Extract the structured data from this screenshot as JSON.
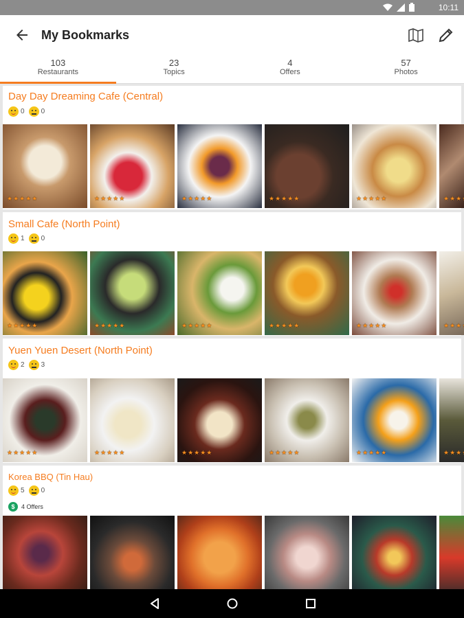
{
  "status": {
    "time": "10:11"
  },
  "header": {
    "title": "My Bookmarks"
  },
  "tabs": [
    {
      "count": "103",
      "label": "Restaurants"
    },
    {
      "count": "23",
      "label": "Topics"
    },
    {
      "count": "4",
      "label": "Offers"
    },
    {
      "count": "57",
      "label": "Photos"
    }
  ],
  "restaurants": [
    {
      "name": "Day Day Dreaming Cafe (Central)",
      "smile": "0",
      "cry": "0",
      "photo_stars": "★★★★★"
    },
    {
      "name": "Small Cafe (North Point)",
      "smile": "1",
      "cry": "0",
      "photo_stars": "★★★★★"
    },
    {
      "name": "Yuen Yuen Desert (North Point)",
      "smile": "2",
      "cry": "3",
      "photo_stars": "★★★★★"
    },
    {
      "name": "Korea BBQ (Tin Hau)",
      "smile": "5",
      "cry": "0",
      "offers": "4 Offers",
      "offer_icon": "$"
    }
  ],
  "colors": {
    "accent": "#f57c1f",
    "offer_badge": "#1aa260"
  }
}
